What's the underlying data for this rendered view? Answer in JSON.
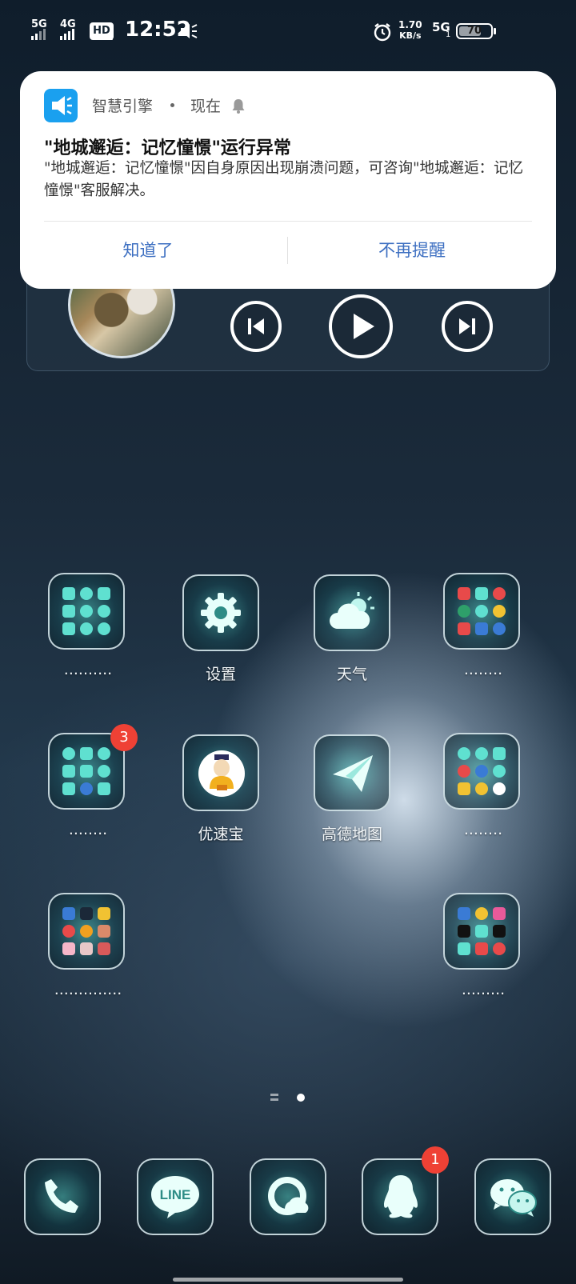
{
  "status_bar": {
    "network1": "5G",
    "network2": "4G",
    "hd_label": "HD",
    "hd_sub": "2",
    "time": "12:52",
    "speed_value": "1.70",
    "speed_unit": "KB/s",
    "network3": "5G",
    "network3_sub": "1",
    "battery": "70",
    "battery_level": 0.7,
    "icons": [
      "volume-icon",
      "alarm-icon"
    ]
  },
  "notification": {
    "app_name": "智慧引擎",
    "time": "现在",
    "title": "\"地城邂逅：记忆憧憬\"运行异常",
    "body": "\"地城邂逅：记忆憧憬\"因自身原因出现崩溃问题，可咨询\"地城邂逅：记忆憧憬\"客服解决。",
    "btn_ok": "知道了",
    "btn_never": "不再提醒",
    "accent": "#3d6fc1",
    "app_icon_color": "#1aa0ef"
  },
  "music_widget": {
    "controls": [
      "previous-icon",
      "play-icon",
      "next-icon"
    ]
  },
  "apps": {
    "folder1_label": "..........",
    "settings_label": "设置",
    "weather_label": "天气",
    "folder2_label": "........",
    "folder3_label": "........",
    "folder3_badge": "3",
    "youxinbao_label": "优速宝",
    "youxinbao_badge_text": "优速宝",
    "amap_label": "高德地图",
    "folder4_label": "........",
    "folder5_label": "..............",
    "folder6_label": "........."
  },
  "dock": {
    "phone": "phone-icon",
    "line_label": "LINE",
    "browser": "browser-icon",
    "qq_badge": "1",
    "wechat": "wechat-icon"
  },
  "page_indicator": {
    "pages": 2,
    "current": 2
  }
}
